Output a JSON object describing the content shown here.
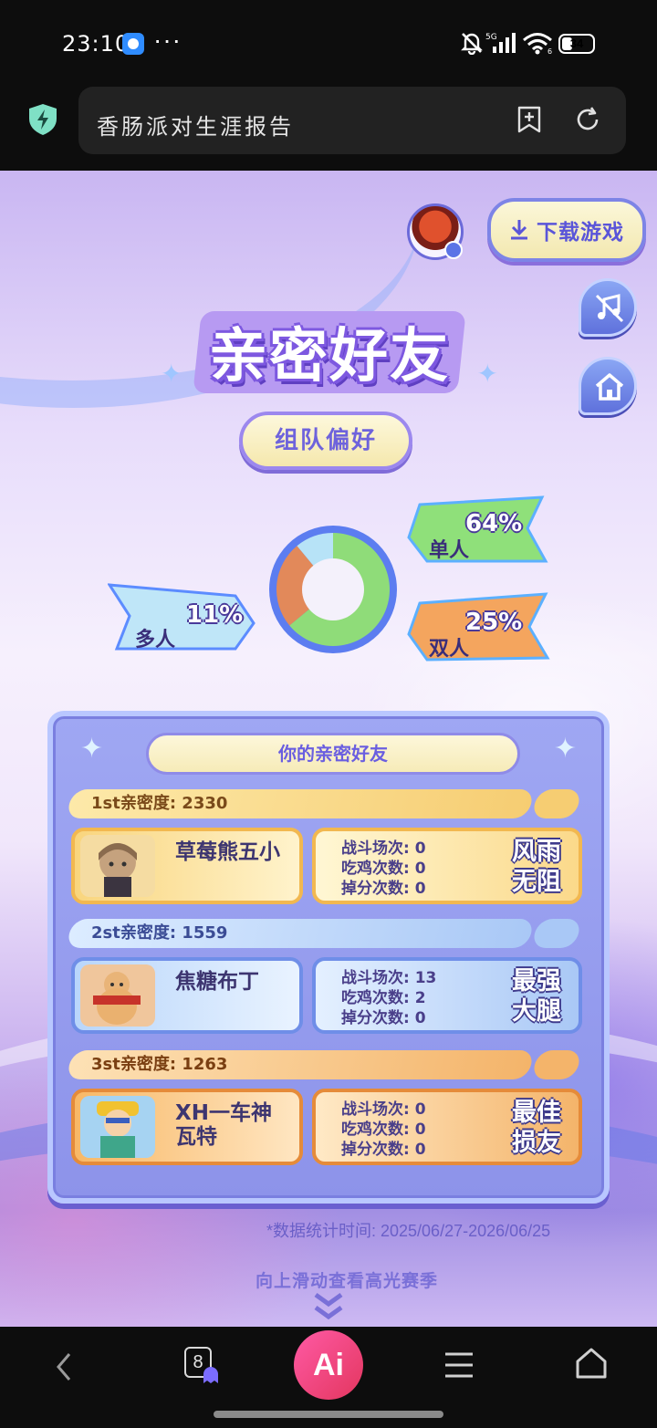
{
  "status_bar": {
    "time": "23:10",
    "more": "···",
    "battery": "34",
    "battery_level": 0.34
  },
  "browser": {
    "page_title": "香肠派对生涯报告",
    "add_bookmark_icon": "add-bookmark-icon",
    "refresh_icon": "refresh-icon"
  },
  "header": {
    "download_label": "下载游戏",
    "music_icon": "music-off-icon",
    "home_icon": "home-icon"
  },
  "section": {
    "title": "亲密好友",
    "pref_label": "组队偏好"
  },
  "team_preference": {
    "chart_data": {
      "type": "pie",
      "categories": [
        "单人",
        "双人",
        "多人"
      ],
      "values": [
        64,
        25,
        11
      ],
      "value_labels": [
        "64%",
        "25%",
        "11%"
      ],
      "colors": [
        "#8fdc79",
        "#e2895a",
        "#b7e3f7"
      ]
    }
  },
  "friends": {
    "title": "你的亲密好友",
    "list": [
      {
        "rank_label": "1st亲密度: 2330",
        "name": "草莓熊五小",
        "battles_label": "战斗场次: 0",
        "wins_label": "吃鸡次数: 0",
        "drops_label": "掉分次数: 0",
        "badge": "风雨无阻",
        "theme": "gold"
      },
      {
        "rank_label": "2st亲密度: 1559",
        "name": "焦糖布丁",
        "battles_label": "战斗场次: 13",
        "wins_label": "吃鸡次数: 2",
        "drops_label": "掉分次数: 0",
        "badge": "最强大腿",
        "theme": "blue"
      },
      {
        "rank_label": "3st亲密度: 1263",
        "name": "XH一车神瓦特",
        "battles_label": "战斗场次: 0",
        "wins_label": "吃鸡次数: 0",
        "drops_label": "掉分次数: 0",
        "badge": "最佳损友",
        "theme": "orange"
      }
    ]
  },
  "footer": {
    "stat_time": "*数据统计时间: 2025/06/27-2026/06/25",
    "scroll_hint": "向上滑动查看高光赛季"
  },
  "bottom_nav": {
    "tab_count": "8",
    "ai_label": "Ai"
  }
}
